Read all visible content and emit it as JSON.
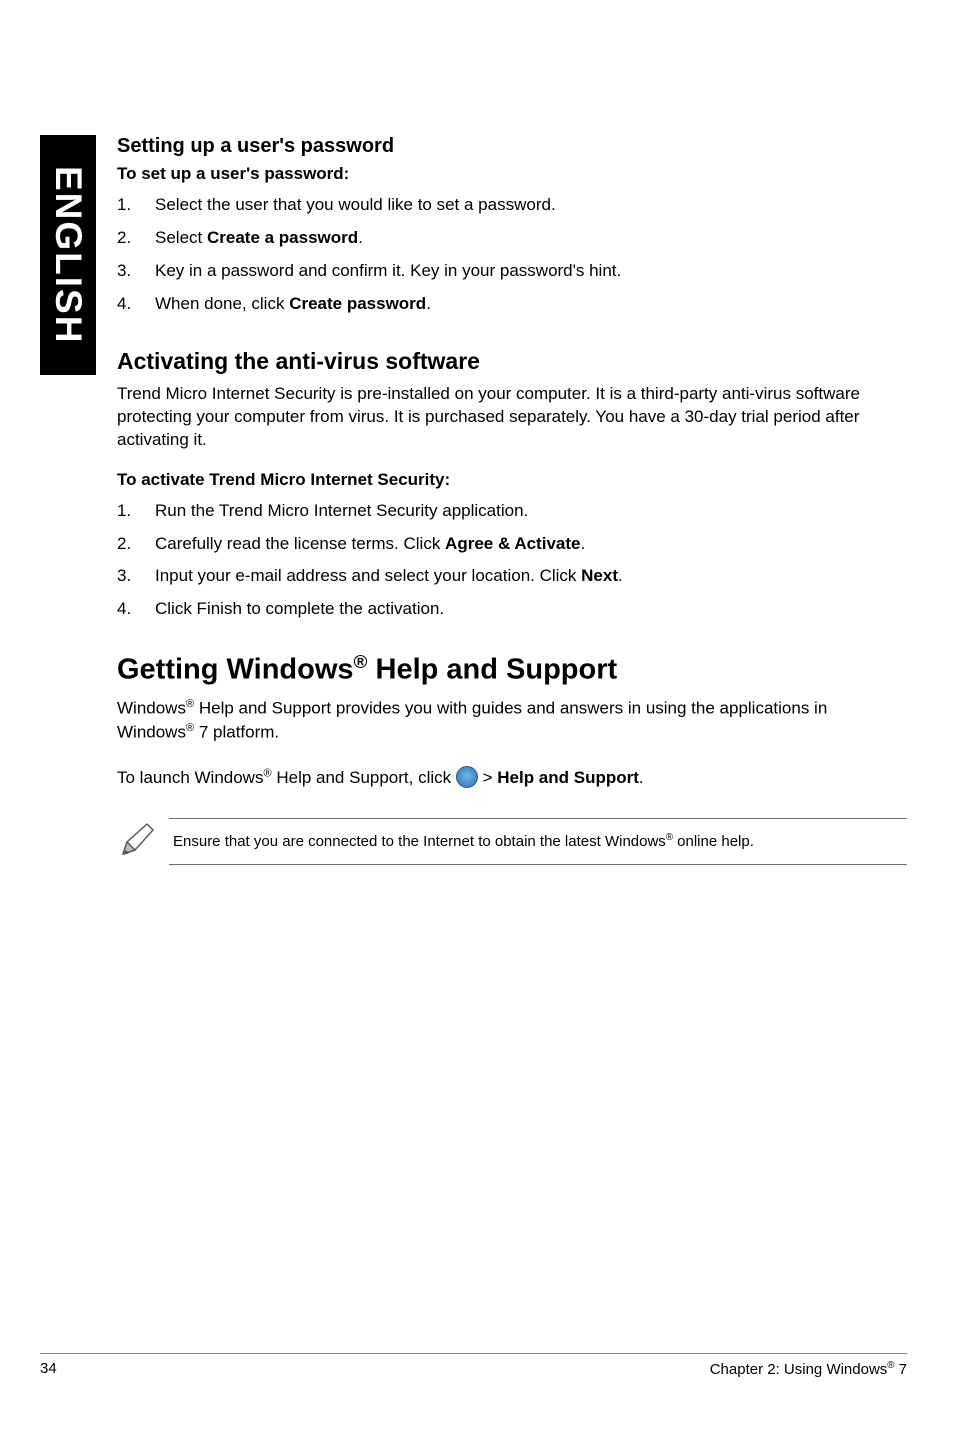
{
  "side_tab": "ENGLISH",
  "section1": {
    "heading": "Setting up a user's password",
    "lead": "To set up a user's password:",
    "steps": {
      "s1_num": "1.",
      "s1_txt_a": "Select the user that you would like to set a password.",
      "s2_num": "2.",
      "s2_txt_a": "Select ",
      "s2_txt_b": "Create a password",
      "s2_txt_c": ".",
      "s3_num": "3.",
      "s3_txt_a": "Key in a password and confirm it. Key in your password's hint.",
      "s4_num": "4.",
      "s4_txt_a": "When done, click ",
      "s4_txt_b": "Create password",
      "s4_txt_c": "."
    }
  },
  "section2": {
    "heading": "Activating the anti-virus software",
    "para": "Trend Micro Internet Security is pre-installed on your computer. It is a third-party anti-virus software protecting your computer from virus. It is purchased separately. You have a 30-day trial period after activating it.",
    "lead": "To activate Trend Micro Internet Security:",
    "steps": {
      "s1_num": "1.",
      "s1_txt_a": "Run the Trend Micro Internet Security application.",
      "s2_num": "2.",
      "s2_txt_a": "Carefully read the license terms. Click ",
      "s2_txt_b": "Agree & Activate",
      "s2_txt_c": ".",
      "s3_num": "3.",
      "s3_txt_a": "Input your e-mail address and select your location. Click ",
      "s3_txt_b": "Next",
      "s3_txt_c": ".",
      "s4_num": "4.",
      "s4_txt_a": "Click Finish to complete the activation."
    }
  },
  "section3": {
    "heading_a": "Getting Windows",
    "heading_sup": "®",
    "heading_b": " Help and Support",
    "para1_a": "Windows",
    "para1_sup1": "®",
    "para1_b": " Help and Support provides you with guides and answers in using the applications in Windows",
    "para1_sup2": "®",
    "para1_c": " 7 platform.",
    "para2_a": "To launch Windows",
    "para2_sup": "®",
    "para2_b": " Help and Support, click ",
    "para2_c": " > ",
    "para2_d": "Help and Support",
    "para2_e": ".",
    "note_a": "Ensure that you are connected to the Internet to obtain the latest Windows",
    "note_sup": "®",
    "note_b": " online help."
  },
  "footer": {
    "page_num": "34",
    "right_a": "Chapter 2: Using Windows",
    "right_sup": "®",
    "right_b": " 7"
  },
  "icons": {
    "start_orb": "windows-start-orb-icon",
    "pencil": "pencil-note-icon"
  }
}
